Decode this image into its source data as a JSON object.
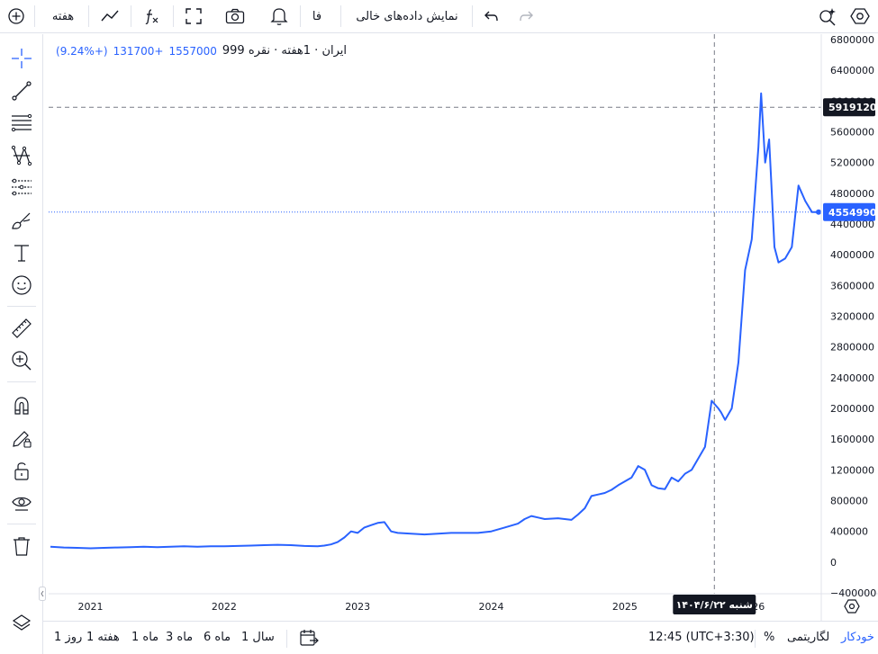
{
  "toolbar": {
    "interval_label": "هفته",
    "language_label": "فا",
    "show_empty_label": "نمایش داده‌های خالی"
  },
  "legend": {
    "symbol": "ایران · 1هفته · نقره 999",
    "last": "1557000",
    "change": "+131700",
    "change_pct": "(+9.24%)"
  },
  "price_axis": {
    "ticks": [
      "6800000",
      "6400000",
      "6000000",
      "5600000",
      "5200000",
      "4800000",
      "4400000",
      "4000000",
      "3600000",
      "3200000",
      "2800000",
      "2400000",
      "2000000",
      "1600000",
      "1200000",
      "800000",
      "400000",
      "0",
      "−400000"
    ],
    "crosshair_price": "5919120",
    "last_price": "4554990"
  },
  "time_axis": {
    "labels": [
      "2021",
      "2022",
      "2023",
      "2024",
      "2025",
      "26"
    ],
    "crosshair_date": "شنبه ۱۴۰۴/۶/۲۲"
  },
  "bottombar": {
    "ranges": [
      "سال 1",
      "ماه 6",
      "ماه 3",
      "ماه 1",
      "هفته 1",
      "روز 1"
    ],
    "clock": "12:45 (UTC+3:30)",
    "percent": "%",
    "log": "لگاریتمی",
    "auto": "خودکار"
  },
  "colors": {
    "line": "#2962ff",
    "crosshair_tag": "#131722",
    "last_tag": "#2962ff"
  },
  "chart_data": {
    "type": "line",
    "title": "",
    "xlabel": "",
    "ylabel": "",
    "ylim": [
      -400000,
      6800000
    ],
    "x_ticks": [
      "2021",
      "2022",
      "2023",
      "2024",
      "2025",
      "26"
    ],
    "series": [
      {
        "name": "نقره 999",
        "x": [
          2020.7,
          2020.8,
          2020.9,
          2021.0,
          2021.1,
          2021.2,
          2021.3,
          2021.4,
          2021.5,
          2021.6,
          2021.7,
          2021.8,
          2021.9,
          2022.0,
          2022.1,
          2022.2,
          2022.3,
          2022.4,
          2022.5,
          2022.6,
          2022.7,
          2022.75,
          2022.8,
          2022.85,
          2022.9,
          2022.95,
          2023.0,
          2023.05,
          2023.1,
          2023.15,
          2023.2,
          2023.25,
          2023.3,
          2023.4,
          2023.5,
          2023.6,
          2023.7,
          2023.8,
          2023.9,
          2024.0,
          2024.1,
          2024.2,
          2024.25,
          2024.3,
          2024.35,
          2024.4,
          2024.5,
          2024.6,
          2024.65,
          2024.7,
          2024.75,
          2024.8,
          2024.85,
          2024.9,
          2024.95,
          2025.0,
          2025.05,
          2025.1,
          2025.15,
          2025.2,
          2025.25,
          2025.3,
          2025.35,
          2025.4,
          2025.45,
          2025.5,
          2025.55,
          2025.6,
          2025.65,
          2025.7,
          2025.72,
          2025.75,
          2025.8,
          2025.85,
          2025.9,
          2025.95,
          2026.0,
          2026.02,
          2026.05,
          2026.08,
          2026.1,
          2026.12,
          2026.15,
          2026.2,
          2026.25,
          2026.3,
          2026.35,
          2026.4,
          2026.45
        ],
        "values": [
          200000,
          190000,
          185000,
          180000,
          185000,
          190000,
          195000,
          200000,
          195000,
          200000,
          205000,
          200000,
          205000,
          205000,
          210000,
          215000,
          220000,
          225000,
          220000,
          210000,
          205000,
          215000,
          230000,
          260000,
          320000,
          400000,
          380000,
          450000,
          480000,
          510000,
          520000,
          400000,
          380000,
          370000,
          360000,
          370000,
          380000,
          380000,
          380000,
          400000,
          450000,
          500000,
          560000,
          600000,
          580000,
          560000,
          570000,
          550000,
          620000,
          700000,
          860000,
          880000,
          900000,
          940000,
          1000000,
          1050000,
          1100000,
          1250000,
          1200000,
          1000000,
          960000,
          950000,
          1100000,
          1050000,
          1150000,
          1200000,
          1350000,
          1500000,
          2100000,
          2000000,
          1950000,
          1850000,
          2000000,
          2600000,
          3800000,
          4200000,
          5400000,
          6100000,
          5200000,
          5500000,
          4800000,
          4100000,
          3900000,
          3950000,
          4100000,
          4900000,
          4700000,
          4556000,
          4554990
        ]
      }
    ]
  }
}
